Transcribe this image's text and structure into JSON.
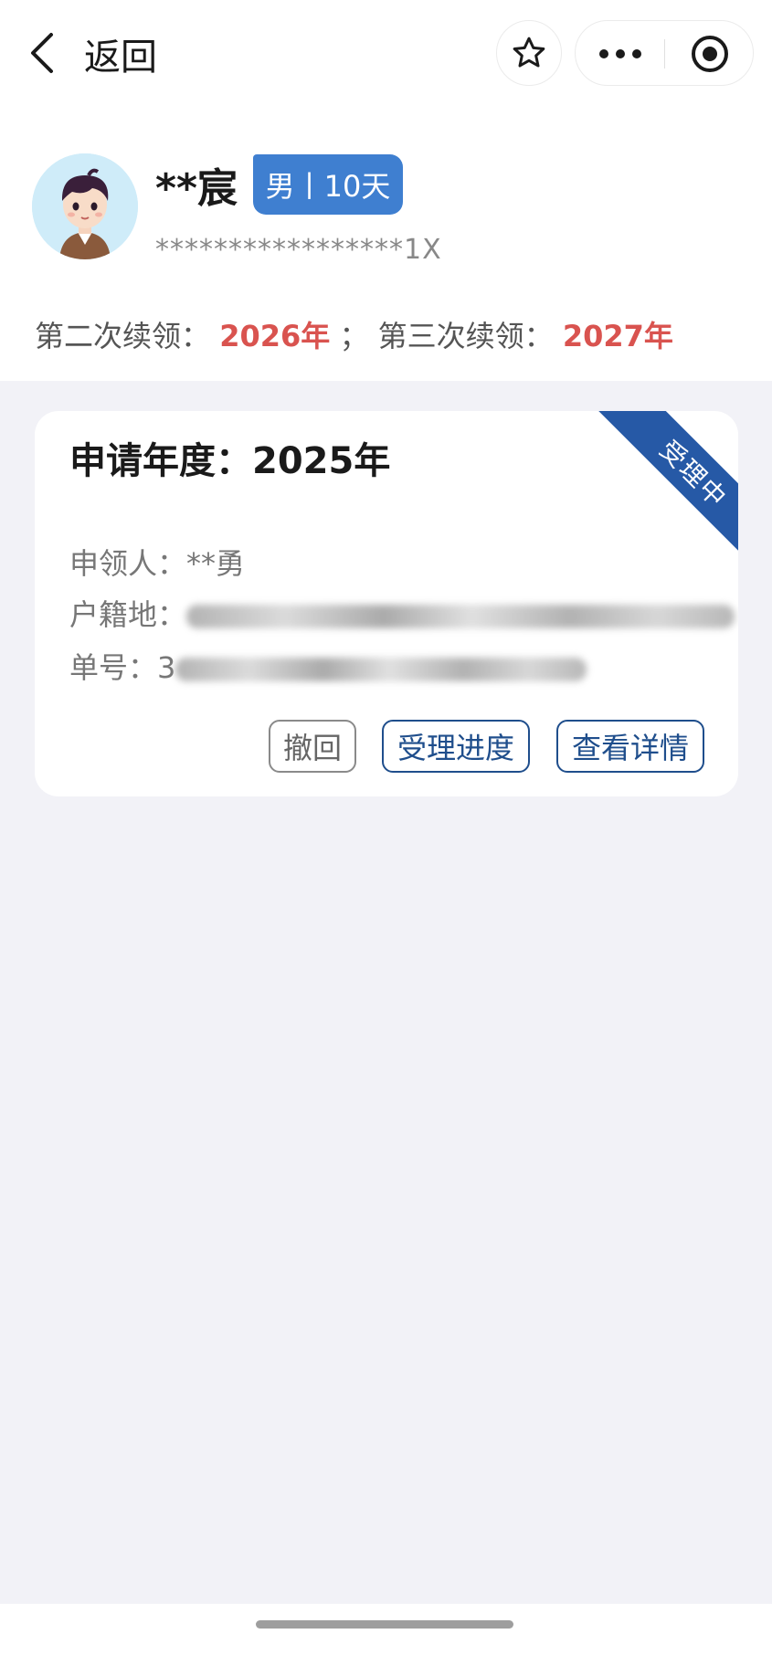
{
  "nav": {
    "back_label": "返回",
    "icons": [
      "chevron-left-icon",
      "star-icon",
      "more-icon",
      "target-icon"
    ]
  },
  "profile": {
    "name": "**宸",
    "tag": "男丨10天",
    "id_number": "*****************1X",
    "renew_second_label": "第二次续领：",
    "renew_second_year": "2026年",
    "renew_sep": "；",
    "renew_third_label": "第三次续领：",
    "renew_third_year": "2027年"
  },
  "card": {
    "title": "申请年度：2025年",
    "status": "受理中",
    "applicant_label": "申领人：",
    "applicant_value": "**勇",
    "hukou_label": "户籍地：",
    "order_label": "单号：",
    "order_prefix": "3",
    "buttons": {
      "withdraw": "撤回",
      "progress": "受理进度",
      "detail": "查看详情"
    }
  },
  "colors": {
    "accent_blue": "#2659a6",
    "tag_blue": "#3f7fd0",
    "highlight_red": "#d9534f",
    "page_bg": "#f2f2f7"
  }
}
